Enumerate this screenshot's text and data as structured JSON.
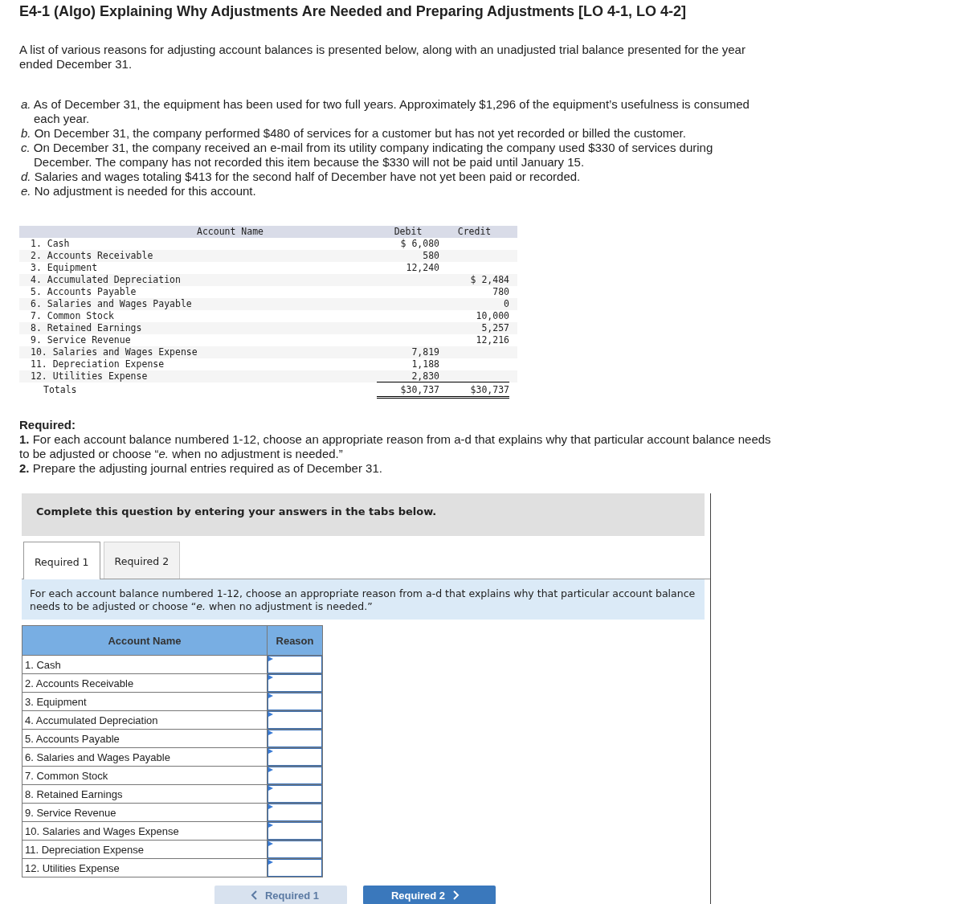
{
  "title": "E4-1 (Algo) Explaining Why Adjustments Are Needed and Preparing Adjustments [LO 4-1, LO 4-2]",
  "intro": "A list of various reasons for adjusting account balances is presented below, along with an unadjusted trial balance presented for the year ended December 31.",
  "reasons": [
    {
      "letter": "a.",
      "text": "As of December 31, the equipment has been used for two full years. Approximately $1,296 of the equipment’s usefulness is consumed each year."
    },
    {
      "letter": "b.",
      "text": "On December 31, the company performed $480 of services for a customer but has not yet recorded or billed the customer."
    },
    {
      "letter": "c.",
      "text": "On December 31, the company received an e-mail from its utility company indicating the company used $330 of services during December. The company has not recorded this item because the $330 will not be paid until January 15."
    },
    {
      "letter": "d.",
      "text": "Salaries and wages totaling $413 for the second half of December have not yet been paid or recorded."
    },
    {
      "letter": "e.",
      "text": "No adjustment is needed for this account."
    }
  ],
  "trial_balance": {
    "columns": [
      "Account Name",
      "Debit",
      "Credit"
    ],
    "rows": [
      {
        "name": "1. Cash",
        "debit": "$ 6,080",
        "credit": ""
      },
      {
        "name": "2. Accounts Receivable",
        "debit": "580",
        "credit": ""
      },
      {
        "name": "3. Equipment",
        "debit": "12,240",
        "credit": ""
      },
      {
        "name": "4. Accumulated Depreciation",
        "debit": "",
        "credit": "$ 2,484"
      },
      {
        "name": "5. Accounts Payable",
        "debit": "",
        "credit": "780"
      },
      {
        "name": "6. Salaries and Wages Payable",
        "debit": "",
        "credit": "0"
      },
      {
        "name": "7. Common Stock",
        "debit": "",
        "credit": "10,000"
      },
      {
        "name": "8. Retained Earnings",
        "debit": "",
        "credit": "5,257"
      },
      {
        "name": "9. Service Revenue",
        "debit": "",
        "credit": "12,216"
      },
      {
        "name": "10. Salaries and Wages Expense",
        "debit": "7,819",
        "credit": ""
      },
      {
        "name": "11. Depreciation Expense",
        "debit": "1,188",
        "credit": ""
      },
      {
        "name": "12. Utilities Expense",
        "debit": "2,830",
        "credit": ""
      }
    ],
    "totals": {
      "label": "Totals",
      "debit": "$30,737",
      "credit": "$30,737"
    }
  },
  "required": {
    "heading": "Required:",
    "items": [
      "**1.** For each account balance numbered 1-12, choose an appropriate reason from a-d that explains why that particular account balance needs to be adjusted or choose “*e.* when no adjustment is needed.”",
      "**2.** Prepare the adjusting journal entries required as of December 31."
    ]
  },
  "question": {
    "banner": "Complete this question by entering your answers in the tabs below.",
    "tabs": [
      {
        "label": "Required 1",
        "selected": true
      },
      {
        "label": "Required 2",
        "selected": false
      }
    ],
    "instruction": "For each account balance numbered 1-12, choose an appropriate reason from a-d that explains why that particular account balance needs to be adjusted or choose “*e.* when no adjustment is needed.”",
    "answer_table": {
      "columns": [
        "Account Name",
        "Reason"
      ],
      "rows": [
        "1. Cash",
        "2. Accounts Receivable",
        "3. Equipment",
        "4. Accumulated Depreciation",
        "5. Accounts Payable",
        "6. Salaries and Wages Payable",
        "7. Common Stock",
        "8. Retained Earnings",
        "9. Service Revenue",
        "10. Salaries and Wages Expense",
        "11. Depreciation Expense",
        "12. Utilities Expense"
      ]
    },
    "nav": [
      {
        "label": "Required 1",
        "kind": "prev",
        "disabled": true
      },
      {
        "label": "Required 2",
        "kind": "next",
        "disabled": false
      }
    ]
  }
}
